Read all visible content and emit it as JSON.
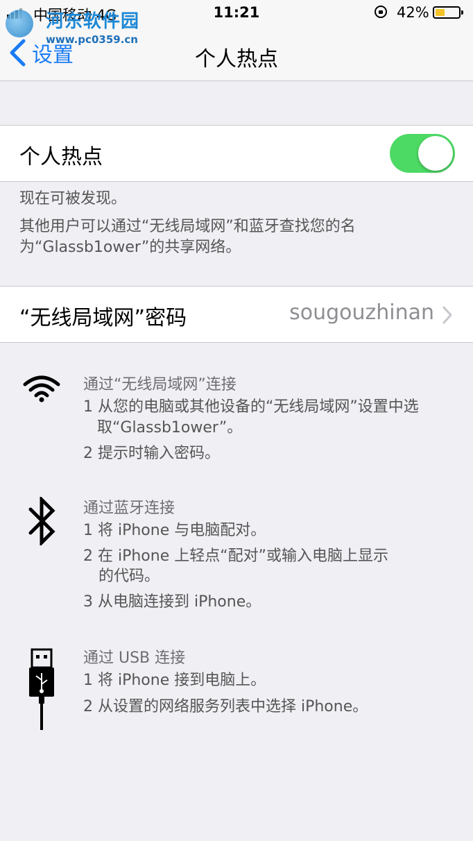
{
  "status_bar": {
    "carrier": "中国移动",
    "network": "4G",
    "time": "11:21",
    "battery_percent": "42%",
    "battery_level": 0.42,
    "battery_color": "#f4c328"
  },
  "watermark": {
    "title": "河东软件园",
    "url": "www.pc0359.cn"
  },
  "nav": {
    "back_label": "设置",
    "title": "个人热点"
  },
  "hotspot": {
    "label": "个人热点",
    "enabled": true,
    "toggle_color": "#4cd964"
  },
  "discoverable_text": "现在可被发现。",
  "discover_desc_line1": "其他用户可以通过“无线局域网”和蓝牙查找您的名",
  "discover_desc_line2": "为“Glassb1ower”的共享网络。",
  "password": {
    "label": "“无线局域网”密码",
    "value": "sougouzhinan"
  },
  "wifi_section": {
    "icon": "wifi-icon",
    "title": "通过“无线局域网”连接",
    "line1": "1 从您的电脑或其他设备的“无线局域网”设置中选",
    "line1b": "取“Glassb1ower”。",
    "line2": "2 提示时输入密码。"
  },
  "bluetooth_section": {
    "icon": "bluetooth-icon",
    "title": "通过蓝牙连接",
    "line1": "1 将 iPhone 与电脑配对。",
    "line2": "2 在 iPhone 上轻点“配对”或输入电脑上显示",
    "line2b": "的代码。",
    "line3": "3 从电脑连接到 iPhone。"
  },
  "usb_section": {
    "icon": "usb-cable-icon",
    "title": "通过 USB 连接",
    "line1": "1 将 iPhone 接到电脑上。",
    "line2": "2 从设置的网络服务列表中选择 iPhone。"
  }
}
